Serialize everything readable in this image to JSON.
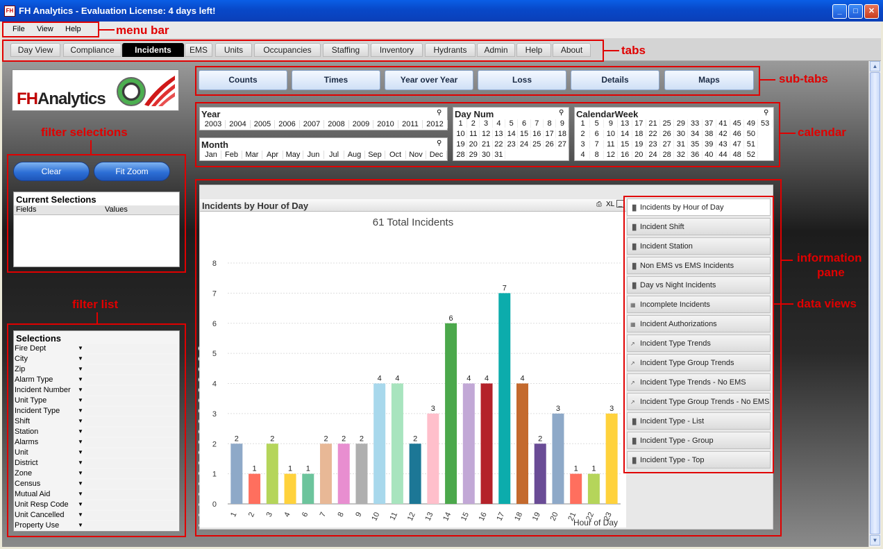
{
  "window": {
    "title": "FH Analytics - Evaluation License: 4 days left!"
  },
  "menu": [
    "File",
    "View",
    "Help"
  ],
  "tabs": [
    "Day View",
    "Compliance",
    "Incidents",
    "EMS",
    "Units",
    "Occupancies",
    "Staffing",
    "Inventory",
    "Hydrants",
    "Admin",
    "Help",
    "About"
  ],
  "active_tab": "Incidents",
  "logo": {
    "fh": "FH",
    "analytics": "Analytics"
  },
  "subtabs": [
    "Counts",
    "Times",
    "Year over Year",
    "Loss",
    "Details",
    "Maps"
  ],
  "buttons": {
    "clear": "Clear",
    "fit_zoom": "Fit Zoom"
  },
  "current_selections": {
    "title": "Current Selections",
    "col_fields": "Fields",
    "col_values": "Values"
  },
  "calendar": {
    "year_title": "Year",
    "years": [
      "2003",
      "2004",
      "2005",
      "2006",
      "2007",
      "2008",
      "2009",
      "2010",
      "2011",
      "2012"
    ],
    "month_title": "Month",
    "months": [
      "Jan",
      "Feb",
      "Mar",
      "Apr",
      "May",
      "Jun",
      "Jul",
      "Aug",
      "Sep",
      "Oct",
      "Nov",
      "Dec"
    ],
    "daynum_title": "Day Num",
    "daynums": [
      "1",
      "2",
      "3",
      "4",
      "5",
      "6",
      "7",
      "8",
      "9",
      "10",
      "11",
      "12",
      "13",
      "14",
      "15",
      "16",
      "17",
      "18",
      "19",
      "20",
      "21",
      "22",
      "23",
      "24",
      "25",
      "26",
      "27",
      "28",
      "29",
      "30",
      "31"
    ],
    "week_title": "CalendarWeek",
    "weeks": [
      "1",
      "5",
      "9",
      "13",
      "17",
      "21",
      "25",
      "29",
      "33",
      "37",
      "41",
      "45",
      "49",
      "53",
      "2",
      "6",
      "10",
      "14",
      "18",
      "22",
      "26",
      "30",
      "34",
      "38",
      "42",
      "46",
      "50",
      "3",
      "7",
      "11",
      "15",
      "19",
      "23",
      "27",
      "31",
      "35",
      "39",
      "43",
      "47",
      "51",
      "4",
      "8",
      "12",
      "16",
      "20",
      "24",
      "28",
      "32",
      "36",
      "40",
      "44",
      "48",
      "52"
    ]
  },
  "selections": {
    "title": "Selections",
    "fields": [
      "Fire Dept",
      "City",
      "Zip",
      "Alarm Type",
      "Incident Number",
      "Unit Type",
      "Incident Type",
      "Shift",
      "Station",
      "Alarms",
      "Unit",
      "District",
      "Zone",
      "Census",
      "Mutual Aid",
      "Unit Resp Code",
      "Unit Cancelled",
      "Property Use"
    ]
  },
  "chart_panel": {
    "caption": "Incidents by Hour of Day",
    "xl": "XL"
  },
  "chart_data": {
    "type": "bar",
    "title": "61 Total Incidents",
    "xlabel": "Hour of Day",
    "ylabel": "",
    "categories": [
      "1",
      "2",
      "3",
      "4",
      "6",
      "7",
      "8",
      "9",
      "10",
      "11",
      "12",
      "13",
      "14",
      "15",
      "16",
      "17",
      "18",
      "19",
      "20",
      "21",
      "22",
      "23"
    ],
    "values": [
      2,
      1,
      2,
      1,
      1,
      2,
      2,
      2,
      4,
      4,
      2,
      3,
      6,
      4,
      4,
      7,
      4,
      2,
      3,
      1,
      1,
      3
    ],
    "colors": [
      "#8EA9C8",
      "#FF6F5E",
      "#B5D55A",
      "#FFD23C",
      "#6CC49C",
      "#E8B896",
      "#E88ED0",
      "#AFAFAF",
      "#A8D8EC",
      "#A8E4BE",
      "#1C7796",
      "#FFBFCB",
      "#4BA84B",
      "#C2A8D6",
      "#B4222A",
      "#0CACAC",
      "#C46A2E",
      "#6A4C96",
      "#8EA9C8",
      "#FF6F5E",
      "#B5D55A",
      "#FFD23C"
    ],
    "yticks": [
      "0",
      "1",
      "2",
      "3",
      "4",
      "5",
      "6",
      "7",
      "8"
    ],
    "ylim": [
      0,
      8
    ],
    "grid": true
  },
  "data_views": [
    "Incidents by Hour of Day",
    "Incident Shift",
    "Incident Station",
    "Non EMS vs EMS Incidents",
    "Day vs Night Incidents",
    "Incomplete Incidents",
    "Incident Authorizations",
    "Incident Type Trends",
    "Incident Type  Group Trends",
    "Incident Type Trends - No EMS",
    "Incident Type  Group Trends - No EMS",
    "Incident Type - List",
    "Incident Type - Group",
    "Incident Type - Top"
  ],
  "data_view_icons": [
    "bar-chart-icon",
    "bar-chart-icon",
    "bar-chart-icon",
    "bar-chart-icon",
    "bar-chart-icon",
    "table-icon",
    "table-icon",
    "line-chart-icon",
    "line-chart-icon",
    "line-chart-icon",
    "line-chart-icon",
    "bar-chart-icon",
    "bar-chart-icon",
    "bar-chart-icon"
  ],
  "annotations": {
    "menu_bar": "menu bar",
    "tabs": "tabs",
    "sub_tabs": "sub-tabs",
    "filter_selections": "filter  selections",
    "calendar": "calendar",
    "information_pane_1": "information",
    "information_pane_2": "pane",
    "data_views": "data views",
    "filter_list": "filter list"
  }
}
